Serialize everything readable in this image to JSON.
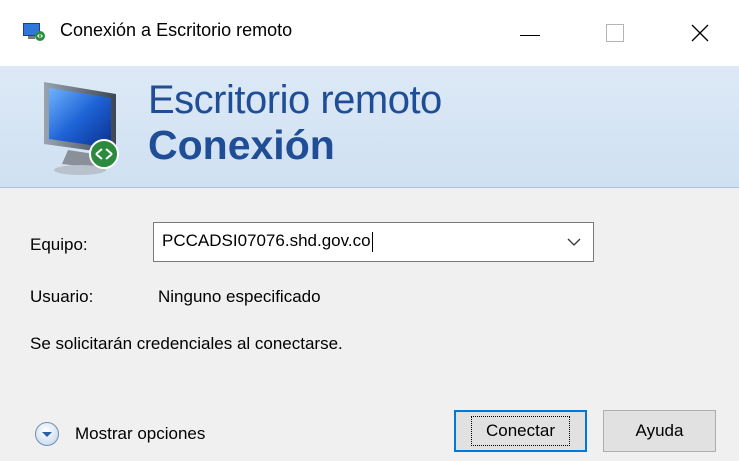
{
  "window": {
    "title": "Conexión a Escritorio remoto",
    "icon": "remote-desktop-icon",
    "controls": [
      "minimize",
      "maximize",
      "close"
    ]
  },
  "banner": {
    "line1": "Escritorio remoto",
    "line2": "Conexión",
    "icon": "monitor-remote-icon"
  },
  "form": {
    "equipo_label": "Equipo:",
    "equipo_value": "PCCADSI07076.shd.gov.co",
    "usuario_label": "Usuario:",
    "usuario_value": "Ninguno especificado",
    "credentials_note": "Se solicitarán credenciales al conectarse."
  },
  "footer": {
    "options_label": "Mostrar opciones",
    "connect_label": "Conectar",
    "help_label": "Ayuda"
  },
  "colors": {
    "banner_text": "#1f4e96",
    "focus_border": "#0078d7"
  }
}
